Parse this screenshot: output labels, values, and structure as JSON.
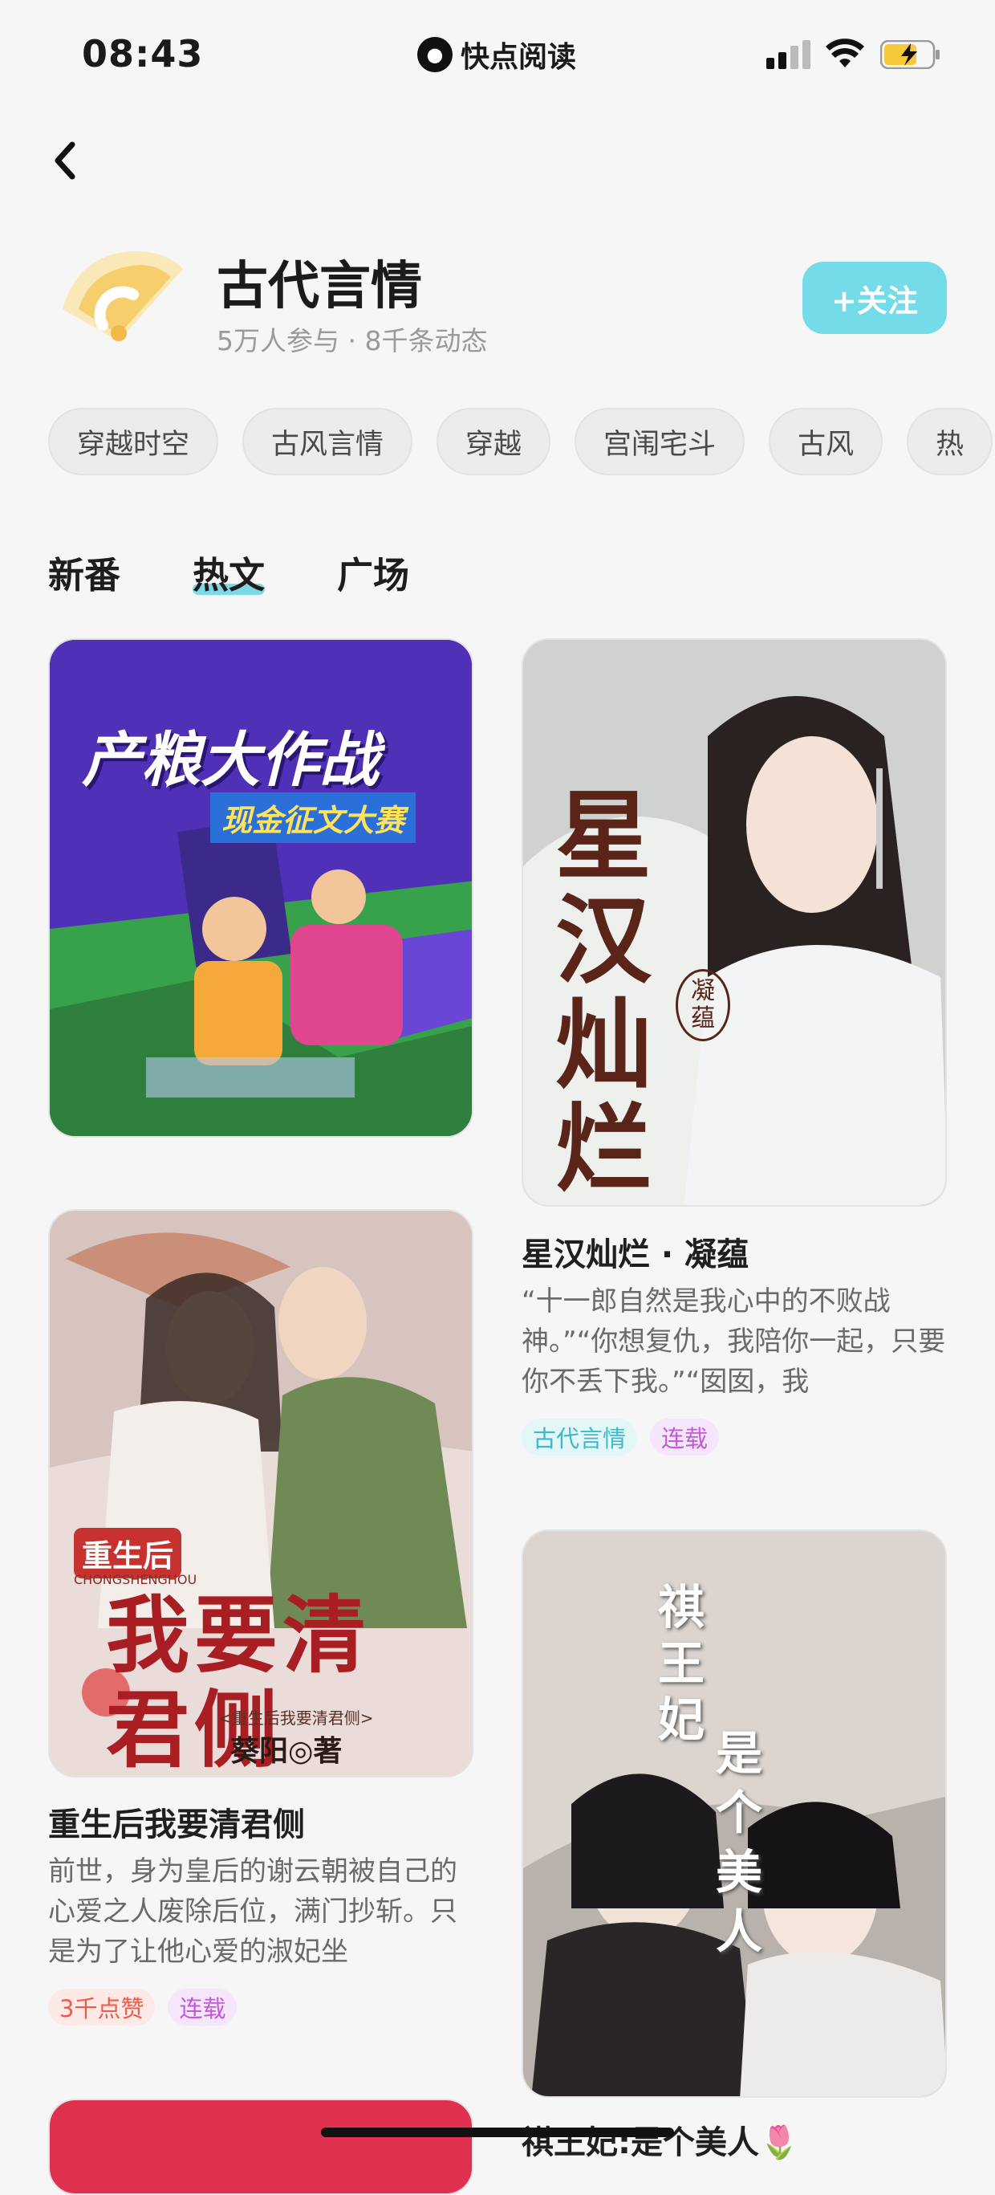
{
  "status_bar": {
    "time": "08:43",
    "app_name": "快点阅读"
  },
  "topic": {
    "title": "古代言情",
    "meta": "5万人参与 · 8千条动态",
    "follow_label": "+关注"
  },
  "chips": [
    "穿越时空",
    "古风言情",
    "穿越",
    "宫闱宅斗",
    "古风",
    "热"
  ],
  "tabs": [
    "新番",
    "热文",
    "广场"
  ],
  "active_tab": "热文",
  "cards": [
    {
      "cover_text": [
        "产粮大作战",
        "现金征文大赛"
      ],
      "title": "",
      "desc": "",
      "badges": []
    },
    {
      "cover_text": [
        "星汉灿烂",
        "凝蕴"
      ],
      "title": "星汉灿烂 · 凝蕴",
      "desc": "“十一郎自然是我心中的不败战神。”“你想复仇，我陪你一起，只要你不丢下我。”“囡囡，我",
      "badges": [
        "古代言情",
        "连载"
      ]
    },
    {
      "cover_text": [
        "重生后",
        "CHONGSHENGHOU",
        "我要清君侧",
        "<重生后我要清君侧>",
        "葵阳◎著"
      ],
      "title": "重生后我要清君侧",
      "desc": "前世，身为皇后的谢云朝被自己的心爱之人废除后位，满门抄斩。只是为了让他心爱的淑妃坐",
      "badges": [
        "3千点赞",
        "连载"
      ]
    },
    {
      "cover_text": [
        "祺王妃",
        "是个美人"
      ],
      "title": "祺王妃:是个美人🌷",
      "desc": "",
      "badges": []
    }
  ],
  "colors": {
    "accent": "#74dbe8",
    "tab_underline": "#7fd9e3"
  }
}
